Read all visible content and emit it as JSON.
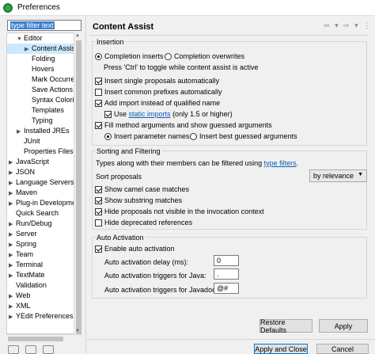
{
  "window": {
    "title": "Preferences"
  },
  "sidebar": {
    "filter_value": "type filter text",
    "items": [
      {
        "label": "Editor",
        "indent": 2,
        "arrow": "v"
      },
      {
        "label": "Content Assist",
        "indent": 3,
        "arrow": ">",
        "selected": true
      },
      {
        "label": "Folding",
        "indent": 3,
        "arrow": ""
      },
      {
        "label": "Hovers",
        "indent": 3,
        "arrow": ""
      },
      {
        "label": "Mark Occurrences",
        "indent": 3,
        "arrow": ""
      },
      {
        "label": "Save Actions",
        "indent": 3,
        "arrow": ""
      },
      {
        "label": "Syntax Coloring",
        "indent": 3,
        "arrow": ""
      },
      {
        "label": "Templates",
        "indent": 3,
        "arrow": ""
      },
      {
        "label": "Typing",
        "indent": 3,
        "arrow": ""
      },
      {
        "label": "Installed JREs",
        "indent": 2,
        "arrow": ">"
      },
      {
        "label": "JUnit",
        "indent": 2,
        "arrow": ""
      },
      {
        "label": "Properties Files Editor",
        "indent": 2,
        "arrow": ""
      },
      {
        "label": "JavaScript",
        "indent": 1,
        "arrow": ">"
      },
      {
        "label": "JSON",
        "indent": 1,
        "arrow": ">"
      },
      {
        "label": "Language Servers",
        "indent": 1,
        "arrow": ">"
      },
      {
        "label": "Maven",
        "indent": 1,
        "arrow": ">"
      },
      {
        "label": "Plug-in Development",
        "indent": 1,
        "arrow": ">"
      },
      {
        "label": "Quick Search",
        "indent": 1,
        "arrow": ""
      },
      {
        "label": "Run/Debug",
        "indent": 1,
        "arrow": ">"
      },
      {
        "label": "Server",
        "indent": 1,
        "arrow": ">"
      },
      {
        "label": "Spring",
        "indent": 1,
        "arrow": ">"
      },
      {
        "label": "Team",
        "indent": 1,
        "arrow": ">"
      },
      {
        "label": "Terminal",
        "indent": 1,
        "arrow": ">"
      },
      {
        "label": "TextMate",
        "indent": 1,
        "arrow": ">"
      },
      {
        "label": "Validation",
        "indent": 1,
        "arrow": ""
      },
      {
        "label": "Web",
        "indent": 1,
        "arrow": ">"
      },
      {
        "label": "XML",
        "indent": 1,
        "arrow": ">"
      },
      {
        "label": "YEdit Preferences",
        "indent": 1,
        "arrow": ">"
      }
    ]
  },
  "main": {
    "title": "Content Assist",
    "insertion": {
      "label": "Insertion",
      "completion_inserts": "Completion inserts",
      "completion_overwrites": "Completion overwrites",
      "hint": "Press 'Ctrl' to toggle while content assist is active",
      "single_proposals": "Insert single proposals automatically",
      "common_prefixes": "Insert common prefixes automatically",
      "add_import": "Add import instead of qualified name",
      "use": "Use",
      "static_imports": "static imports",
      "only_15": "(only 1.5 or higher)",
      "fill_method": "Fill method arguments and show guessed arguments",
      "insert_param_names": "Insert parameter names",
      "insert_best_guessed": "Insert best guessed arguments"
    },
    "sorting": {
      "label": "Sorting and Filtering",
      "types_text": "Types along with their members can be filtered using",
      "type_filters": "type filters",
      "period": ".",
      "sort_proposals": "Sort proposals",
      "sort_value": "by relevance",
      "camel_case": "Show camel case matches",
      "substring": "Show substring matches",
      "hide_not_visible": "Hide proposals not visible in the invocation context",
      "hide_deprecated": "Hide deprecated references"
    },
    "activation": {
      "label": "Auto Activation",
      "enable": "Enable auto activation",
      "delay_label": "Auto activation delay (ms):",
      "delay_value": "0",
      "java_label": "Auto activation triggers for Java:",
      "java_value": ".",
      "javadoc_label": "Auto activation triggers for Javadoc:",
      "javadoc_value": "@#"
    },
    "restore_defaults": "Restore Defaults",
    "apply": "Apply"
  },
  "footer": {
    "apply_and_close": "Apply and Close",
    "cancel": "Cancel"
  }
}
